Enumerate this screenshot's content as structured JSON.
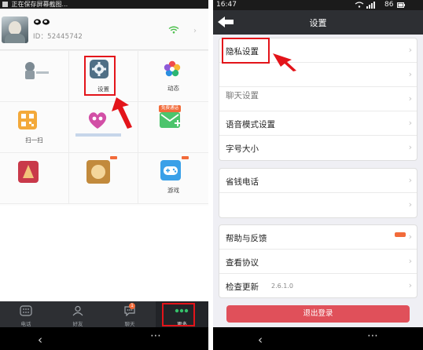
{
  "left": {
    "status_bar": {
      "text": "正在保存屏幕截图..."
    },
    "profile": {
      "id_text": "ID：52445742"
    },
    "grid": {
      "settings_label": "设置",
      "moments_label": "动态",
      "scan_label": "扫一扫",
      "free_badge": "免费通话",
      "games_label": "游戏"
    },
    "tabs": [
      {
        "label": "电话"
      },
      {
        "label": "好友"
      },
      {
        "label": "聊天"
      },
      {
        "label": "更多"
      }
    ],
    "chat_badge": "1"
  },
  "right": {
    "status_bar": {
      "time": "16:47",
      "battery": "86"
    },
    "header": {
      "title": "设置"
    },
    "group1": [
      {
        "label": "隐私设置"
      },
      {
        "label": ""
      },
      {
        "label": "聊天设置"
      },
      {
        "label": "语音模式设置"
      },
      {
        "label": "字号大小"
      }
    ],
    "group2": [
      {
        "label": "省钱电话"
      },
      {
        "label": ""
      }
    ],
    "group3": [
      {
        "label": "帮助与反馈"
      },
      {
        "label": "查看协议"
      },
      {
        "label": "检查更新",
        "value": "2.6.1.0"
      }
    ],
    "logout_label": "退出登录"
  },
  "colors": {
    "highlight": "#e3141a",
    "logout": "#e0505a",
    "tabbar": "#2d2f33"
  }
}
